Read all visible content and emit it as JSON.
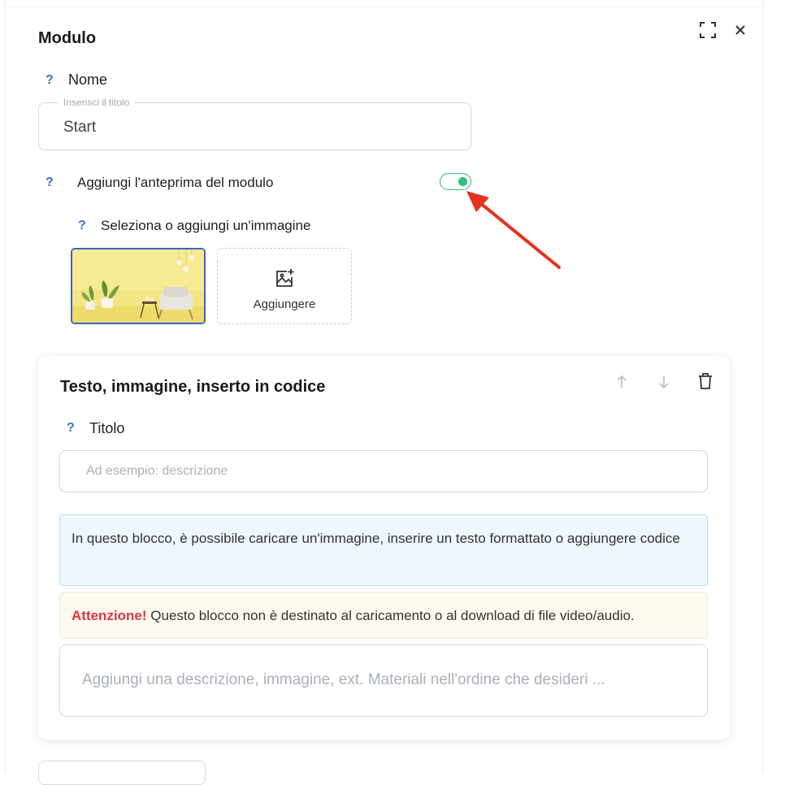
{
  "modal": {
    "title": "Modulo"
  },
  "name_section": {
    "help": "?",
    "label": "Nome",
    "input_legend": "Inserisci il titolo",
    "input_value": "Start"
  },
  "preview_section": {
    "help": "?",
    "label": "Aggiungi l'anteprima del modulo",
    "toggle_on": true,
    "toggle_color": "#2fbf7f"
  },
  "image_section": {
    "help": "?",
    "label": "Seleziona o aggiungi un'immagine",
    "add_label": "Aggiungere"
  },
  "block": {
    "title": "Testo, immagine, inserto in codice",
    "title_field": {
      "help": "?",
      "label": "Titolo",
      "placeholder": "Ad esempio: descrizione"
    },
    "info_text": "In questo blocco, è possibile caricare un'immagine, inserire un testo formattato o aggiungere codice",
    "warning": {
      "strong": "Attenzione!",
      "text": " Questo blocco non è destinato al caricamento o al download di file video/audio."
    },
    "editor_placeholder": "Aggiungi una descrizione, immagine, ext. Materiali nell'ordine che desideri ..."
  },
  "colors": {
    "accent_blue": "#3b6fd4",
    "toggle_green": "#2fbf7f",
    "warning_red": "#d9363e",
    "annotation_arrow": "#e8301e"
  }
}
